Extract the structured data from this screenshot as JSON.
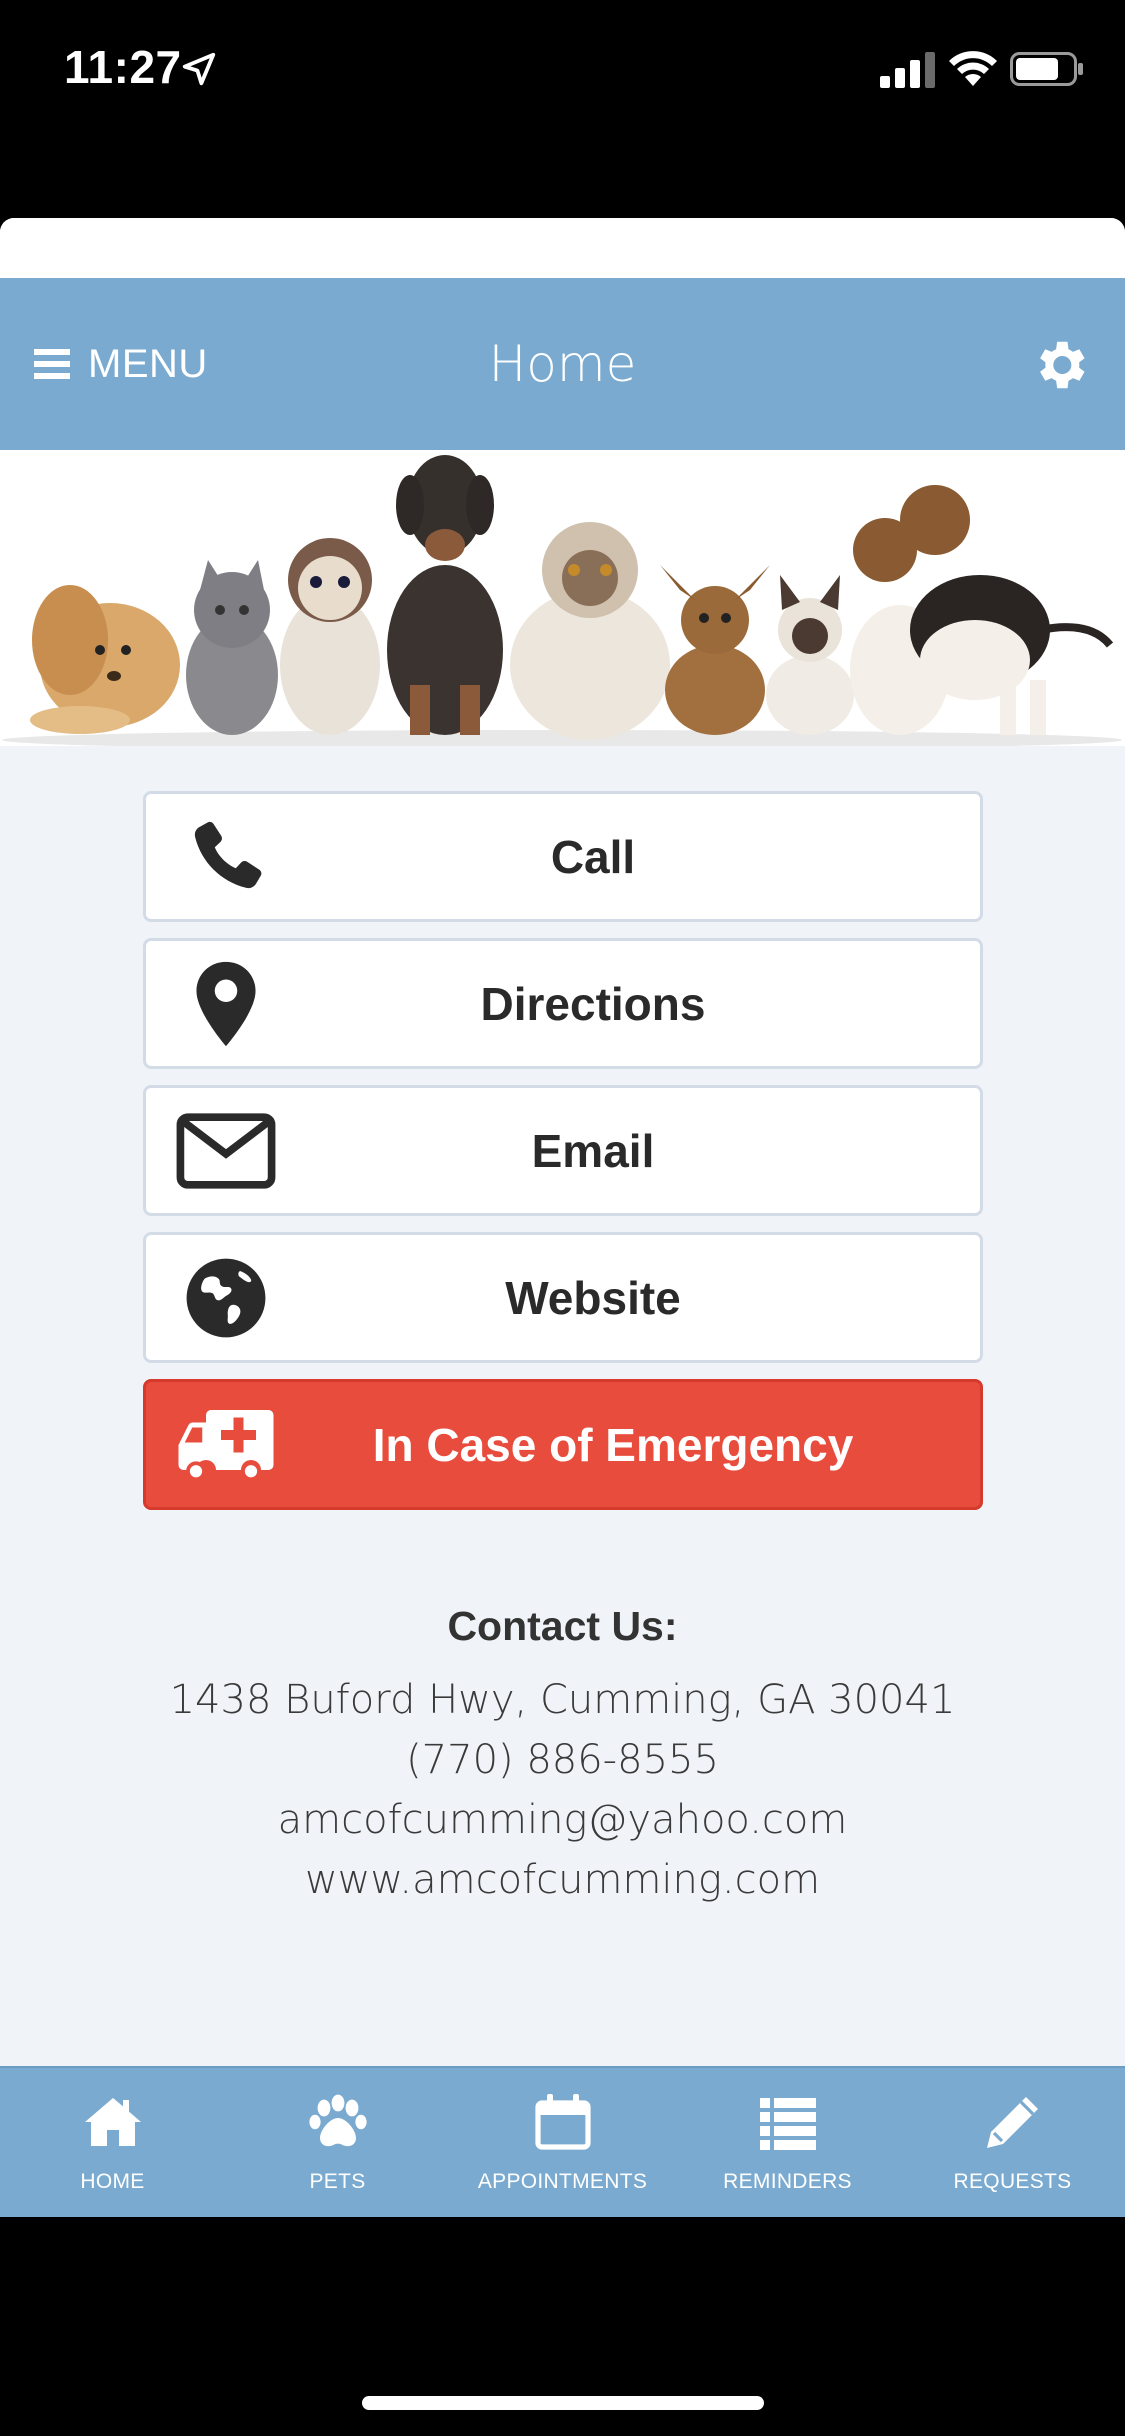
{
  "status_bar": {
    "time": "11:27"
  },
  "header": {
    "menu_label": "MENU",
    "title": "Home"
  },
  "actions": [
    {
      "label": "Call",
      "icon": "phone-icon"
    },
    {
      "label": "Directions",
      "icon": "map-pin-icon"
    },
    {
      "label": "Email",
      "icon": "envelope-icon"
    },
    {
      "label": "Website",
      "icon": "globe-icon"
    },
    {
      "label": "In Case of Emergency",
      "icon": "ambulance-icon"
    }
  ],
  "contact": {
    "heading": "Contact Us:",
    "address": "1438 Buford Hwy, Cumming, GA 30041",
    "phone": "(770) 886-8555",
    "email": "amcofcumming@yahoo.com",
    "website": "www.amcofcumming.com"
  },
  "tabs": [
    {
      "label": "HOME",
      "icon": "home-icon"
    },
    {
      "label": "PETS",
      "icon": "paw-icon"
    },
    {
      "label": "APPOINTMENTS",
      "icon": "calendar-icon"
    },
    {
      "label": "REMINDERS",
      "icon": "list-icon"
    },
    {
      "label": "REQUESTS",
      "icon": "pencil-icon"
    }
  ],
  "colors": {
    "header_bg": "#7aaacf",
    "emergency_bg": "#e84c3d",
    "page_bg": "#f0f4f8"
  }
}
